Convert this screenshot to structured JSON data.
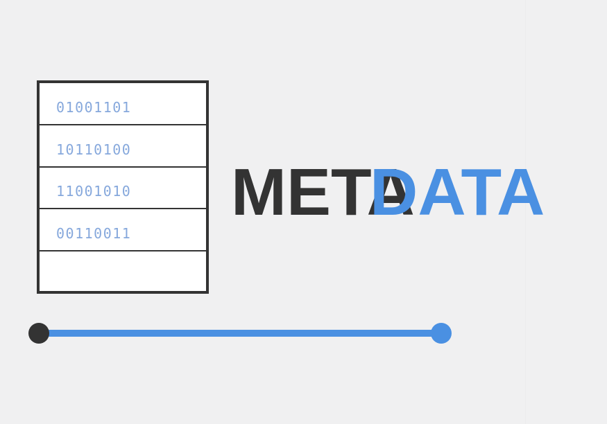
{
  "colors": {
    "background": "#f0f0f1",
    "dark": "#333333",
    "accent": "#4a90e2",
    "binary_text": "#86a8dc"
  },
  "table": {
    "rows": [
      "01001101",
      "10110100",
      "11001010",
      "00110011",
      ""
    ]
  },
  "headline": {
    "word1": "META",
    "word2": "DATA"
  },
  "icons": {
    "slider_start": "circle-handle",
    "slider_end": "circle-handle"
  }
}
